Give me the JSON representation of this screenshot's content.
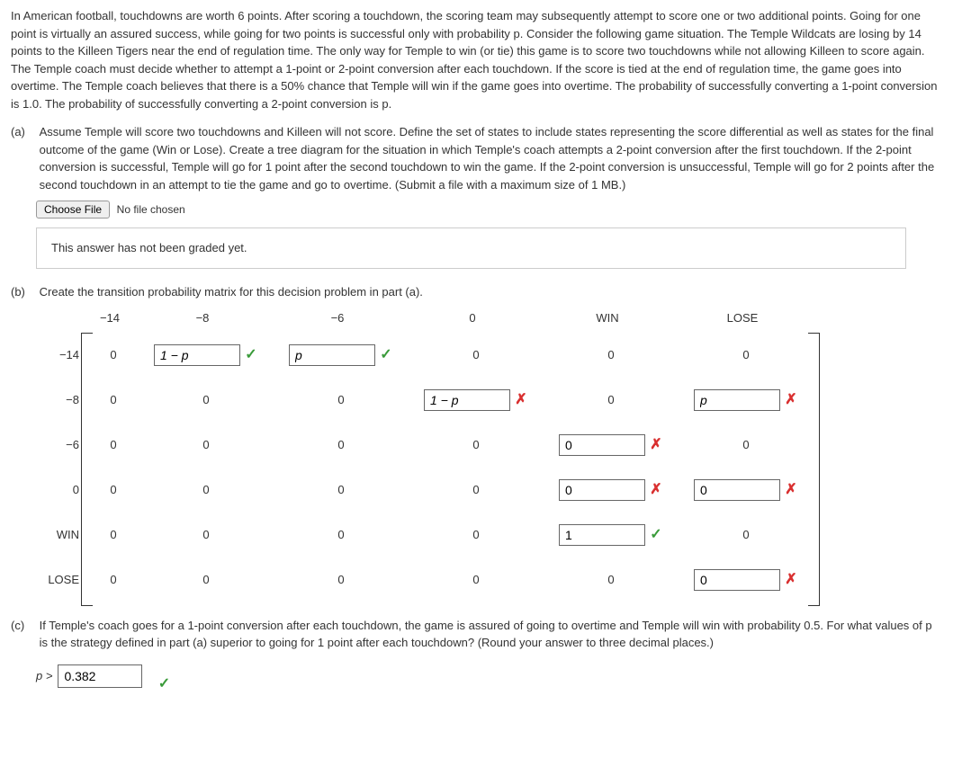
{
  "intro": "In American football, touchdowns are worth 6 points. After scoring a touchdown, the scoring team may subsequently attempt to score one or two additional points. Going for one point is virtually an assured success, while going for two points is successful only with probability p. Consider the following game situation. The Temple Wildcats are losing by 14 points to the Killeen Tigers near the end of regulation time. The only way for Temple to win (or tie) this game is to score two touchdowns while not allowing Killeen to score again. The Temple coach must decide whether to attempt a 1-point or 2-point conversion after each touchdown. If the score is tied at the end of regulation time, the game goes into overtime. The Temple coach believes that there is a 50% chance that Temple will win if the game goes into overtime. The probability of successfully converting a 1-point conversion is 1.0. The probability of successfully converting a 2-point conversion is p.",
  "parts": {
    "a": {
      "label": "(a)",
      "text": "Assume Temple will score two touchdowns and Killeen will not score. Define the set of states to include states representing the score differential as well as states for the final outcome of the game (Win or Lose). Create a tree diagram for the situation in which Temple's coach attempts a 2-point conversion after the first touchdown. If the 2-point conversion is successful, Temple will go for 1 point after the second touchdown to win the game. If the 2-point conversion is unsuccessful, Temple will go for 2 points after the second touchdown in an attempt to tie the game and go to overtime. (Submit a file with a maximum size of 1 MB.)",
      "file_button": "Choose File",
      "file_status": "No file chosen",
      "grade_status": "This answer has not been graded yet."
    },
    "b": {
      "label": "(b)",
      "text": "Create the transition probability matrix for this decision problem in part (a).",
      "col_headers": [
        "−14",
        "−8",
        "−6",
        "0",
        "WIN",
        "LOSE"
      ],
      "row_labels": [
        "−14",
        "−8",
        "−6",
        "0",
        "WIN",
        "LOSE"
      ],
      "rows": [
        [
          {
            "type": "text",
            "val": "0"
          },
          {
            "type": "input",
            "val": "1 − p",
            "mark": "correct"
          },
          {
            "type": "input",
            "val": "p",
            "mark": "correct"
          },
          {
            "type": "text",
            "val": "0"
          },
          {
            "type": "text",
            "val": "0"
          },
          {
            "type": "text",
            "val": "0"
          }
        ],
        [
          {
            "type": "text",
            "val": "0"
          },
          {
            "type": "text",
            "val": "0"
          },
          {
            "type": "text",
            "val": "0"
          },
          {
            "type": "input",
            "val": "1 − p",
            "mark": "wrong"
          },
          {
            "type": "text",
            "val": "0"
          },
          {
            "type": "input",
            "val": "p",
            "mark": "wrong"
          }
        ],
        [
          {
            "type": "text",
            "val": "0"
          },
          {
            "type": "text",
            "val": "0"
          },
          {
            "type": "text",
            "val": "0"
          },
          {
            "type": "text",
            "val": "0"
          },
          {
            "type": "input",
            "val": "0",
            "mark": "wrong"
          },
          {
            "type": "text",
            "val": "0"
          }
        ],
        [
          {
            "type": "text",
            "val": "0"
          },
          {
            "type": "text",
            "val": "0"
          },
          {
            "type": "text",
            "val": "0"
          },
          {
            "type": "text",
            "val": "0"
          },
          {
            "type": "input",
            "val": "0",
            "mark": "wrong"
          },
          {
            "type": "input",
            "val": "0",
            "mark": "wrong"
          }
        ],
        [
          {
            "type": "text",
            "val": "0"
          },
          {
            "type": "text",
            "val": "0"
          },
          {
            "type": "text",
            "val": "0"
          },
          {
            "type": "text",
            "val": "0"
          },
          {
            "type": "input",
            "val": "1",
            "mark": "correct"
          },
          {
            "type": "text",
            "val": "0"
          }
        ],
        [
          {
            "type": "text",
            "val": "0"
          },
          {
            "type": "text",
            "val": "0"
          },
          {
            "type": "text",
            "val": "0"
          },
          {
            "type": "text",
            "val": "0"
          },
          {
            "type": "text",
            "val": "0"
          },
          {
            "type": "input",
            "val": "0",
            "mark": "wrong"
          }
        ]
      ]
    },
    "c": {
      "label": "(c)",
      "text": "If Temple's coach goes for a 1-point conversion after each touchdown, the game is assured of going to overtime and Temple will win with probability 0.5. For what values of p is the strategy defined in part (a) superior to going for 1 point after each touchdown? (Round your answer to three decimal places.)",
      "prefix": "p >",
      "answer": "0.382",
      "mark": "correct"
    }
  }
}
